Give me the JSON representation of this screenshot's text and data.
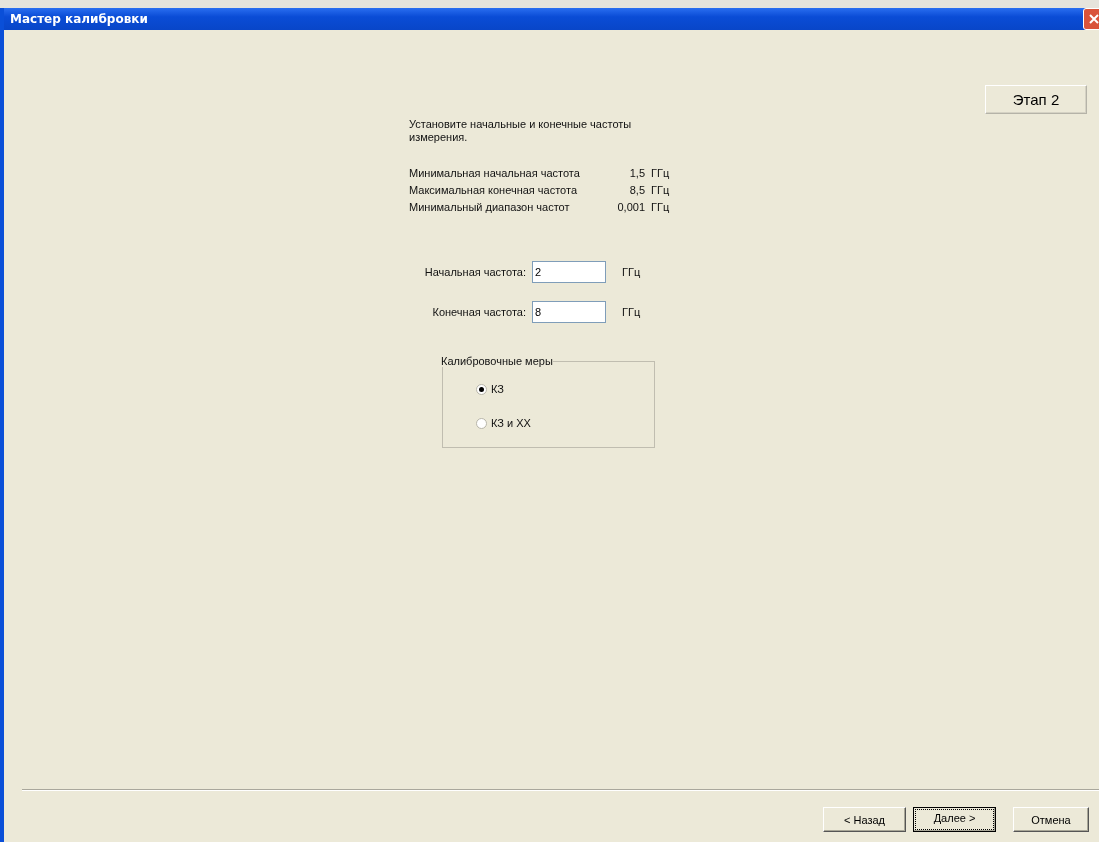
{
  "window": {
    "title": "Мастер калибровки"
  },
  "stage": "Этап 2",
  "instruction": "Установите начальные и конечные частоты измерения.",
  "limits": [
    {
      "label": "Минимальная начальная частота",
      "value": "1,5",
      "unit": "ГГц"
    },
    {
      "label": "Максимальная конечная частота",
      "value": "8,5",
      "unit": "ГГц"
    },
    {
      "label": "Минимальный диапазон частот",
      "value": "0,001",
      "unit": "ГГц"
    }
  ],
  "fields": [
    {
      "label": "Начальная частота:",
      "value": "2",
      "unit": "ГГц"
    },
    {
      "label": "Конечная частота:",
      "value": "8",
      "unit": "ГГц"
    }
  ],
  "calibration_group": {
    "title": "Калибровочные меры",
    "options": [
      {
        "label": "КЗ",
        "selected": true
      },
      {
        "label": "КЗ и ХХ",
        "selected": false
      }
    ]
  },
  "buttons": [
    {
      "label": "< Назад",
      "default": false
    },
    {
      "label": "Далее >",
      "default": true
    },
    {
      "label": "Отмена",
      "default": false
    }
  ]
}
